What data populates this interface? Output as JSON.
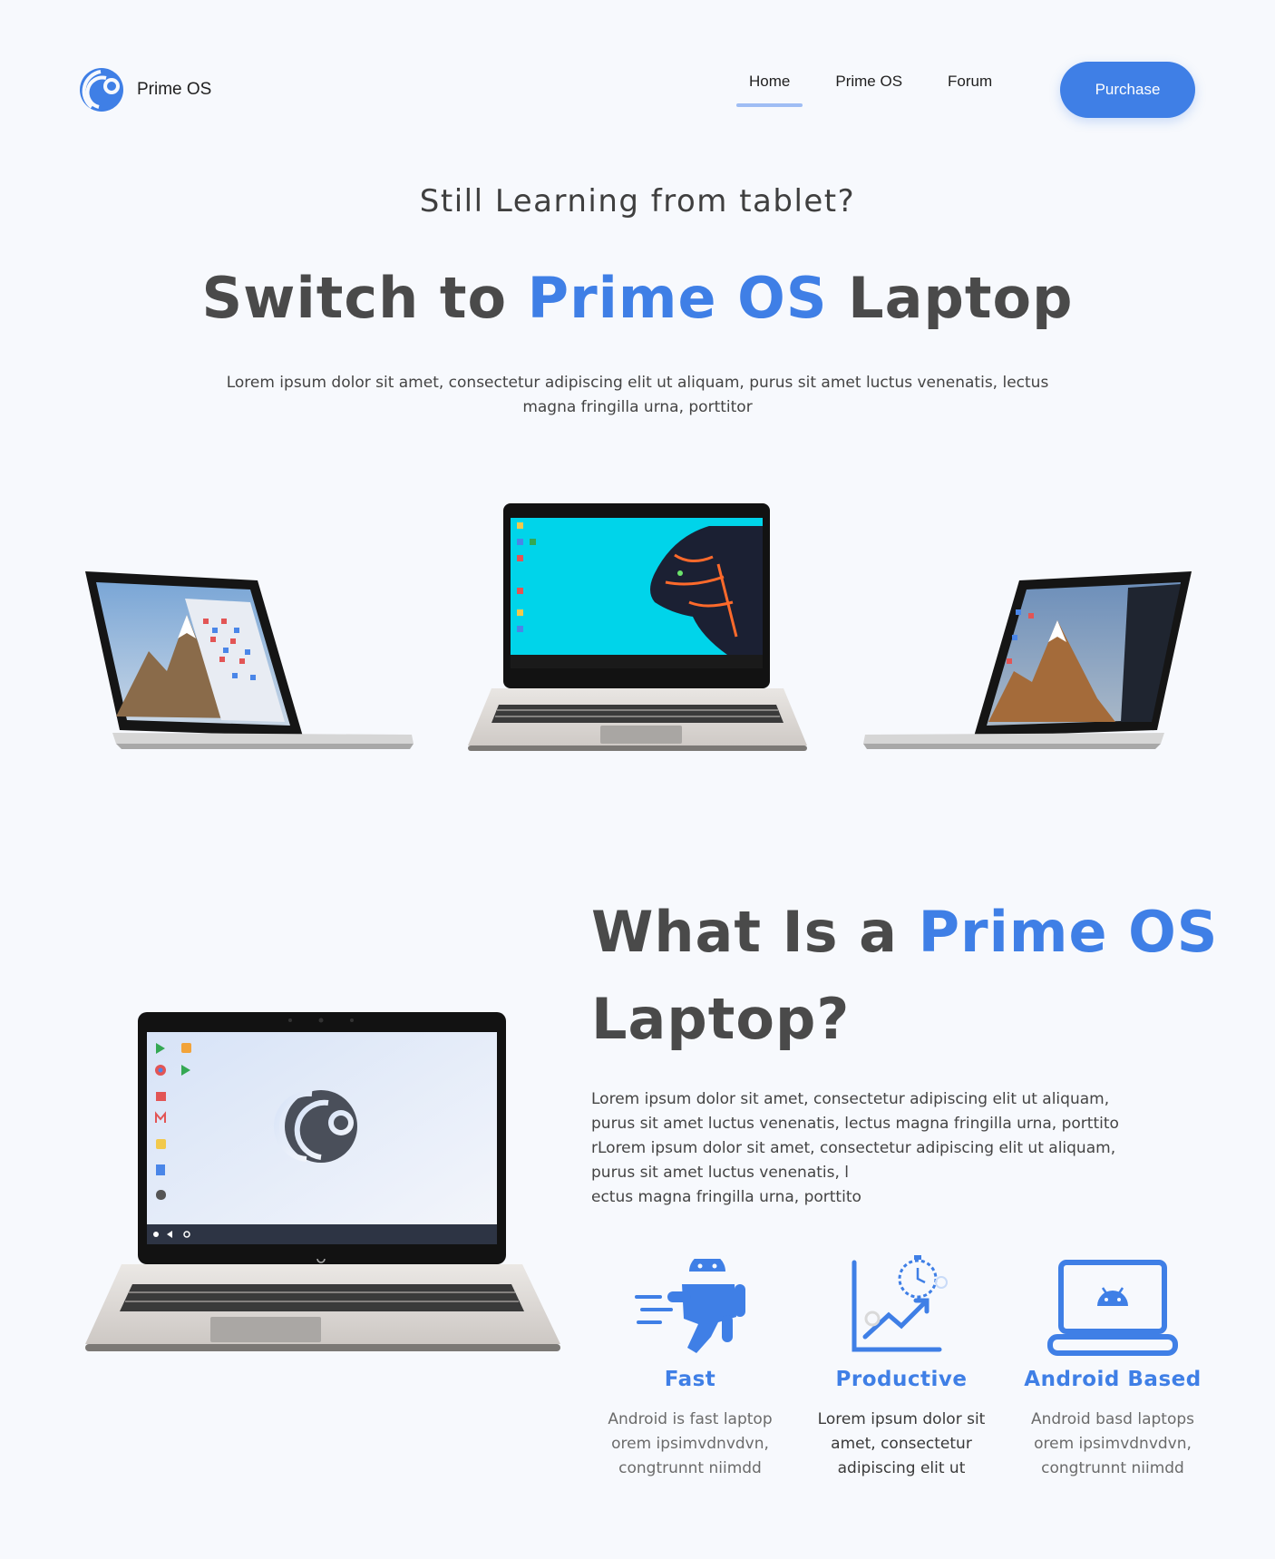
{
  "header": {
    "brand": "Prime OS",
    "nav": [
      {
        "label": "Home",
        "active": true
      },
      {
        "label": "Prime OS",
        "active": false
      },
      {
        "label": "Forum",
        "active": false
      }
    ],
    "purchase_label": "Purchase"
  },
  "hero": {
    "subtitle": "Still Learning from tablet?",
    "title_pre": "Switch to ",
    "title_accent": "Prime OS",
    "title_post": " Laptop",
    "description": "Lorem ipsum dolor sit amet, consectetur adipiscing elit ut aliquam, purus sit amet luctus venenatis, lectus magna fringilla urna, porttitor"
  },
  "what": {
    "title_pre": "What Is a ",
    "title_accent": "Prime OS",
    "title_post": "Laptop?",
    "description_lines": [
      "Lorem ipsum dolor sit amet, consectetur adipiscing elit ut aliquam,",
      "purus sit amet luctus venenatis, lectus magna fringilla urna, porttito",
      "rLorem ipsum dolor sit amet, consectetur adipiscing elit ut aliquam,",
      "purus sit amet luctus venenatis, l",
      "ectus magna fringilla urna, porttito"
    ]
  },
  "features": [
    {
      "icon": "android-running-icon",
      "title": "Fast",
      "desc_lines": [
        "Android is fast laptop",
        "orem ipsimvdnvdvn,",
        "congtrunnt niimdd"
      ]
    },
    {
      "icon": "growth-chart-icon",
      "title": "Productive",
      "desc_lines": [
        "Lorem ipsum dolor sit",
        "amet, consectetur",
        "adipiscing elit ut"
      ]
    },
    {
      "icon": "android-laptop-icon",
      "title": "Android Based",
      "desc_lines": [
        "Android basd laptops",
        "orem ipsimvdnvdvn,",
        "congtrunnt niimdd"
      ]
    }
  ],
  "colors": {
    "accent": "#3f7fe6",
    "background": "#f7f9fd",
    "heading": "#4a4a4a"
  }
}
